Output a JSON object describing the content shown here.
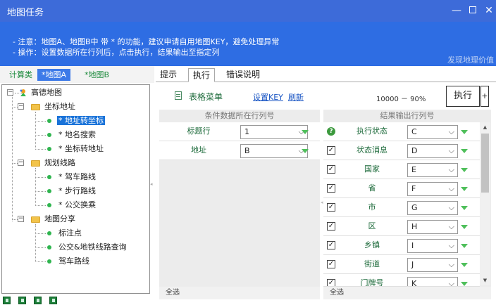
{
  "window": {
    "title": "地图任务"
  },
  "notice": {
    "line1": "- 注意：地图A、地图B中 带 * 的功能，建议申请自用地图KEY，避免处理异常",
    "line2": "- 操作：设置数据所在行列后，点击执行，结果输出至指定列",
    "brand": "发现地理价值"
  },
  "left_tabs": [
    {
      "label": "计算类"
    },
    {
      "label": "*地图A"
    },
    {
      "label": "*地图B"
    }
  ],
  "tree": {
    "root": "高德地图",
    "groups": [
      {
        "label": "坐标地址",
        "items": [
          "* 地址转坐标",
          "* 地名搜索",
          "* 坐标转地址"
        ]
      },
      {
        "label": "规划线路",
        "items": [
          "* 驾车路线",
          "* 步行路线",
          "* 公交换乘"
        ]
      },
      {
        "label": "地图分享",
        "items": [
          "标注点",
          "公交&地铁线路查询",
          "驾车路线"
        ]
      }
    ]
  },
  "right_tabs": [
    {
      "label": "提示"
    },
    {
      "label": "执行"
    },
    {
      "label": "错误说明"
    }
  ],
  "toolbar": {
    "menu_label": "表格菜单",
    "set_key": "设置KEY",
    "refresh": "刷新",
    "progress": "10000 － 90%",
    "run": "执行",
    "plus": "+"
  },
  "condition_panel": {
    "header": "条件数据所在行列号",
    "rows": [
      {
        "name": "标题行",
        "value": "1"
      },
      {
        "name": "地址",
        "value": "B"
      }
    ],
    "footer": "全选"
  },
  "output_panel": {
    "header": "结果输出行列号",
    "rows": [
      {
        "name": "执行状态",
        "value": "C",
        "icon": "help-icon"
      },
      {
        "name": "状态消息",
        "value": "D",
        "checked": true
      },
      {
        "name": "国家",
        "value": "E",
        "checked": true
      },
      {
        "name": "省",
        "value": "F",
        "checked": true
      },
      {
        "name": "市",
        "value": "G",
        "checked": true
      },
      {
        "name": "区",
        "value": "H",
        "checked": true
      },
      {
        "name": "乡镇",
        "value": "I",
        "checked": true
      },
      {
        "name": "街道",
        "value": "J",
        "checked": true
      },
      {
        "name": "门牌号",
        "value": "K",
        "checked": true
      }
    ],
    "footer": "全选"
  },
  "colors": {
    "titlebar": "#3d6bd9",
    "notice_bg": "#2e6de3",
    "selected": "#1a73d9",
    "accent_green": "#4fbf5b"
  }
}
